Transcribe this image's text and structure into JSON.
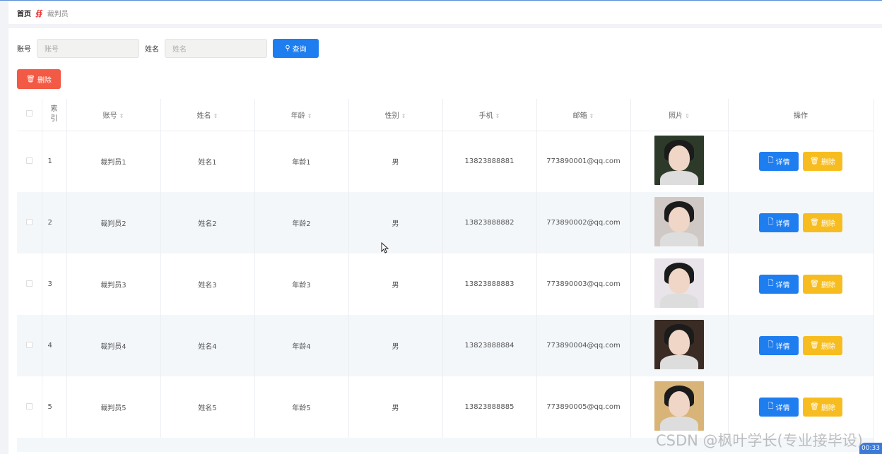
{
  "breadcrumb": {
    "home": "首页",
    "sep": "∯",
    "current": "裁判员"
  },
  "search": {
    "account_label": "账号",
    "account_placeholder": "账号",
    "name_label": "姓名",
    "name_placeholder": "姓名",
    "query_label": "查询"
  },
  "delete_label": "删除",
  "table": {
    "headers": {
      "index": "索引",
      "account": "账号",
      "name": "姓名",
      "age": "年龄",
      "gender": "性别",
      "phone": "手机",
      "email": "邮箱",
      "photo": "照片",
      "ops": "操作"
    },
    "detail_label": "详情",
    "delete_label": "删除",
    "rows": [
      {
        "index": "1",
        "account": "裁判员1",
        "name": "姓名1",
        "age": "年龄1",
        "gender": "男",
        "phone": "13823888881",
        "email": "773890001@qq.com",
        "photo_bg": "#2d3a2a"
      },
      {
        "index": "2",
        "account": "裁判员2",
        "name": "姓名2",
        "age": "年龄2",
        "gender": "男",
        "phone": "13823888882",
        "email": "773890002@qq.com",
        "photo_bg": "#cfc8c4"
      },
      {
        "index": "3",
        "account": "裁判员3",
        "name": "姓名3",
        "age": "年龄3",
        "gender": "男",
        "phone": "13823888883",
        "email": "773890003@qq.com",
        "photo_bg": "#e9e3ea"
      },
      {
        "index": "4",
        "account": "裁判员4",
        "name": "姓名4",
        "age": "年龄4",
        "gender": "男",
        "phone": "13823888884",
        "email": "773890004@qq.com",
        "photo_bg": "#3a2c24"
      },
      {
        "index": "5",
        "account": "裁判员5",
        "name": "姓名5",
        "age": "年龄5",
        "gender": "男",
        "phone": "13823888885",
        "email": "773890005@qq.com",
        "photo_bg": "#d8b478"
      }
    ]
  },
  "watermark": "CSDN @枫叶学长(专业接毕设)",
  "timer": "00:33",
  "colors": {
    "primary": "#1e7ef0",
    "danger": "#f25a45",
    "warning": "#f7bd20"
  }
}
